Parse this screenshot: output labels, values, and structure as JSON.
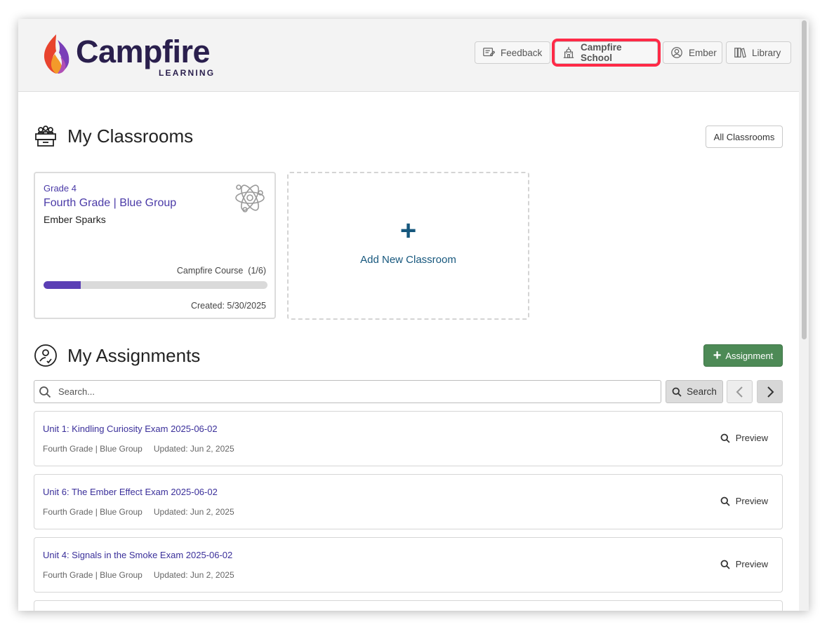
{
  "header": {
    "logo_word": "Campfire",
    "logo_sub": "LEARNING",
    "nav": [
      {
        "label": "Feedback",
        "icon": "feedback-icon"
      },
      {
        "label": "Campfire School",
        "icon": "school-icon",
        "highlighted": true
      },
      {
        "label": "Ember",
        "icon": "user-circle-icon"
      },
      {
        "label": "Library",
        "icon": "library-icon"
      }
    ]
  },
  "classrooms": {
    "title": "My Classrooms",
    "all_button": "All Classrooms",
    "card": {
      "grade": "Grade 4",
      "name": "Fourth Grade | Blue Group",
      "teacher": "Ember Sparks",
      "course": "Campfire Course  (1/6)",
      "progress_fraction": 0.1667,
      "created": "Created: 5/30/2025"
    },
    "add_label": "Add New Classroom",
    "add_symbol": "+"
  },
  "assignments": {
    "title": "My Assignments",
    "add_button": "Assignment",
    "add_button_symbol": "+",
    "search_placeholder": "Search...",
    "search_button": "Search",
    "items": [
      {
        "title": "Unit 1: Kindling Curiosity Exam 2025-06-02",
        "classroom": "Fourth Grade | Blue Group",
        "updated": "Updated: Jun 2, 2025",
        "action": "Preview"
      },
      {
        "title": "Unit 6: The Ember Effect Exam 2025-06-02",
        "classroom": "Fourth Grade | Blue Group",
        "updated": "Updated: Jun 2, 2025",
        "action": "Preview"
      },
      {
        "title": "Unit 4: Signals in the Smoke Exam 2025-06-02",
        "classroom": "Fourth Grade | Blue Group",
        "updated": "Updated: Jun 2, 2025",
        "action": "Preview"
      }
    ]
  },
  "colors": {
    "brand_dark": "#2a1f4d",
    "link_purple": "#4a3aa7",
    "progress": "#5b3fb5",
    "add_blue": "#16577d",
    "assign_green": "#4d8a56",
    "highlight_red": "#ff2a47"
  }
}
